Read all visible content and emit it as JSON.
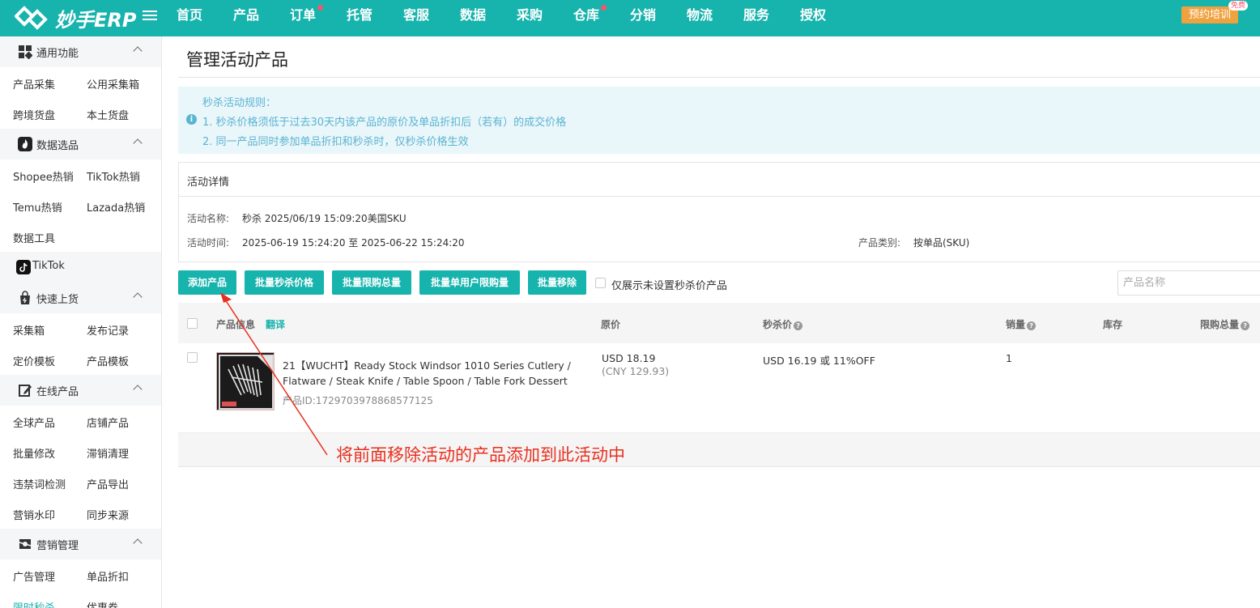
{
  "app": {
    "logo_text": "妙手ERP",
    "nav": [
      "首页",
      "产品",
      "订单",
      "托管",
      "客服",
      "数据",
      "采购",
      "仓库",
      "分销",
      "物流",
      "服务",
      "授权"
    ],
    "train_label": "预约培训",
    "free_badge": "免费"
  },
  "sidebar": {
    "sec_common": "通用功能",
    "collect": "产品采集",
    "public_box": "公用采集箱",
    "cross_border": "跨境货盘",
    "local_goods": "本土货盘",
    "sec_data": "数据选品",
    "shopee_hot": "Shopee热销",
    "tiktok_hot": "TikTok热销",
    "temu_hot": "Temu热销",
    "lazada_hot": "Lazada热销",
    "data_tools": "数据工具",
    "tiktok": "TikTok",
    "sec_fast": "快速上货",
    "collect_box": "采集箱",
    "publish_log": "发布记录",
    "price_tpl": "定价模板",
    "product_tpl": "产品模板",
    "sec_online": "在线产品",
    "global_prod": "全球产品",
    "shop_prod": "店铺产品",
    "batch_edit": "批量修改",
    "slow_clear": "滞销清理",
    "forbidden": "违禁词检测",
    "export": "产品导出",
    "watermark": "营销水印",
    "sync_source": "同步来源",
    "sec_marketing": "营销管理",
    "ads": "广告管理",
    "discount": "单品折扣",
    "flash": "限时秒杀",
    "coupon": "优惠券"
  },
  "page": {
    "title": "管理活动产品",
    "rules": {
      "heading": "秒杀活动规则：",
      "rule1": "1. 秒杀价格须低于过去30天内该产品的原价及单品折扣后（若有）的成交价格",
      "rule2": "2. 同一产品同时参加单品折扣和秒杀时，仅秒杀价格生效"
    },
    "detail": {
      "heading": "活动详情",
      "name_label": "活动名称:",
      "name_value": "秒杀 2025/06/19 15:09:20美国SKU",
      "time_label": "活动时间:",
      "time_value": "2025-06-19 15:24:20 至 2025-06-22 15:24:20",
      "type_label": "产品类别:",
      "type_value": "按单品(SKU)"
    },
    "actions": {
      "add": "添加产品",
      "batch_price": "批量秒杀价格",
      "batch_total": "批量限购总量",
      "batch_user": "批量单用户限购量",
      "batch_remove": "批量移除",
      "only_unset": "仅展示未设置秒杀价产品",
      "search_placeholder": "产品名称"
    },
    "table": {
      "headers": {
        "info": "产品信息",
        "translate": "翻译",
        "orig_price": "原价",
        "flash_price": "秒杀价",
        "sales": "销量",
        "stock": "库存",
        "limit_total": "限购总量"
      },
      "rows": [
        {
          "name": "21【WUCHT】Ready Stock Windsor 1010 Series Cutlery / Flatware / Steak Knife / Table Spoon / Table Fork Dessert …",
          "product_id": "产品ID:1729703978868577125",
          "orig_price": "USD 18.19",
          "orig_price_cny": "(CNY 129.93)",
          "flash_price": "USD 16.19 或 11%OFF",
          "sales": "1"
        }
      ]
    },
    "annotation": "将前面移除活动的产品添加到此活动中"
  }
}
